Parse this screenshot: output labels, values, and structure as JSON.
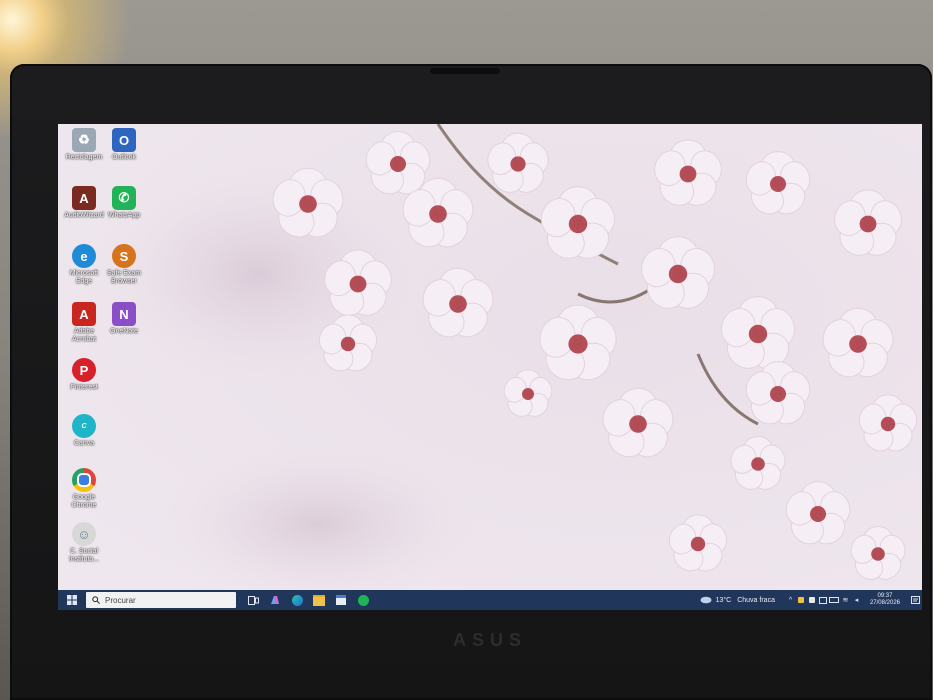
{
  "desktop": {
    "icons": [
      {
        "label": "Reciclagem",
        "icon": "recycle-bin-icon",
        "color": "#9aa8b6"
      },
      {
        "label": "Outlook",
        "icon": "outlook-icon",
        "color": "#2d65c0"
      },
      {
        "label": "AudioWizard",
        "icon": "audiowizard-icon",
        "color": "#7a2a1e"
      },
      {
        "label": "WhatsApp",
        "icon": "whatsapp-icon",
        "color": "#22b257"
      },
      {
        "label": "Microsoft Edge",
        "icon": "edge-icon",
        "color": "#1f8ad6"
      },
      {
        "label": "Safe Exam Browser",
        "icon": "safe-exam-browser-icon",
        "color": "#d6741e"
      },
      {
        "label": "Adobe Acrobat",
        "icon": "acrobat-icon",
        "color": "#c8261f"
      },
      {
        "label": "OneNote",
        "icon": "onenote-icon",
        "color": "#8a4fc7"
      },
      {
        "label": "Pinterest",
        "icon": "pinterest-icon",
        "color": "#d6202a"
      },
      {
        "label": "Canva",
        "icon": "canva-icon",
        "color": "#1eb5c8"
      },
      {
        "label": "Google Chrome",
        "icon": "chrome-icon",
        "color": "#e0453a"
      },
      {
        "label": "C. Social Instituto...",
        "icon": "app-shortcut-icon",
        "color": "#d8d8d8"
      }
    ]
  },
  "taskbar": {
    "search_placeholder": "Procurar",
    "apps": [
      "task-view-icon",
      "copilot-icon",
      "edge-icon",
      "file-explorer-icon",
      "calendar-icon",
      "whatsapp-icon"
    ],
    "weather_temp": "13°C",
    "weather_desc": "Chuva fraca",
    "time": "09:37",
    "date": "27/08/2026"
  },
  "brand": "ASUS",
  "colors": {
    "taskbar": "#20365a",
    "search_box": "#f2f2f2",
    "petal": "#f6eef5",
    "petal_center": "#a8323c"
  }
}
